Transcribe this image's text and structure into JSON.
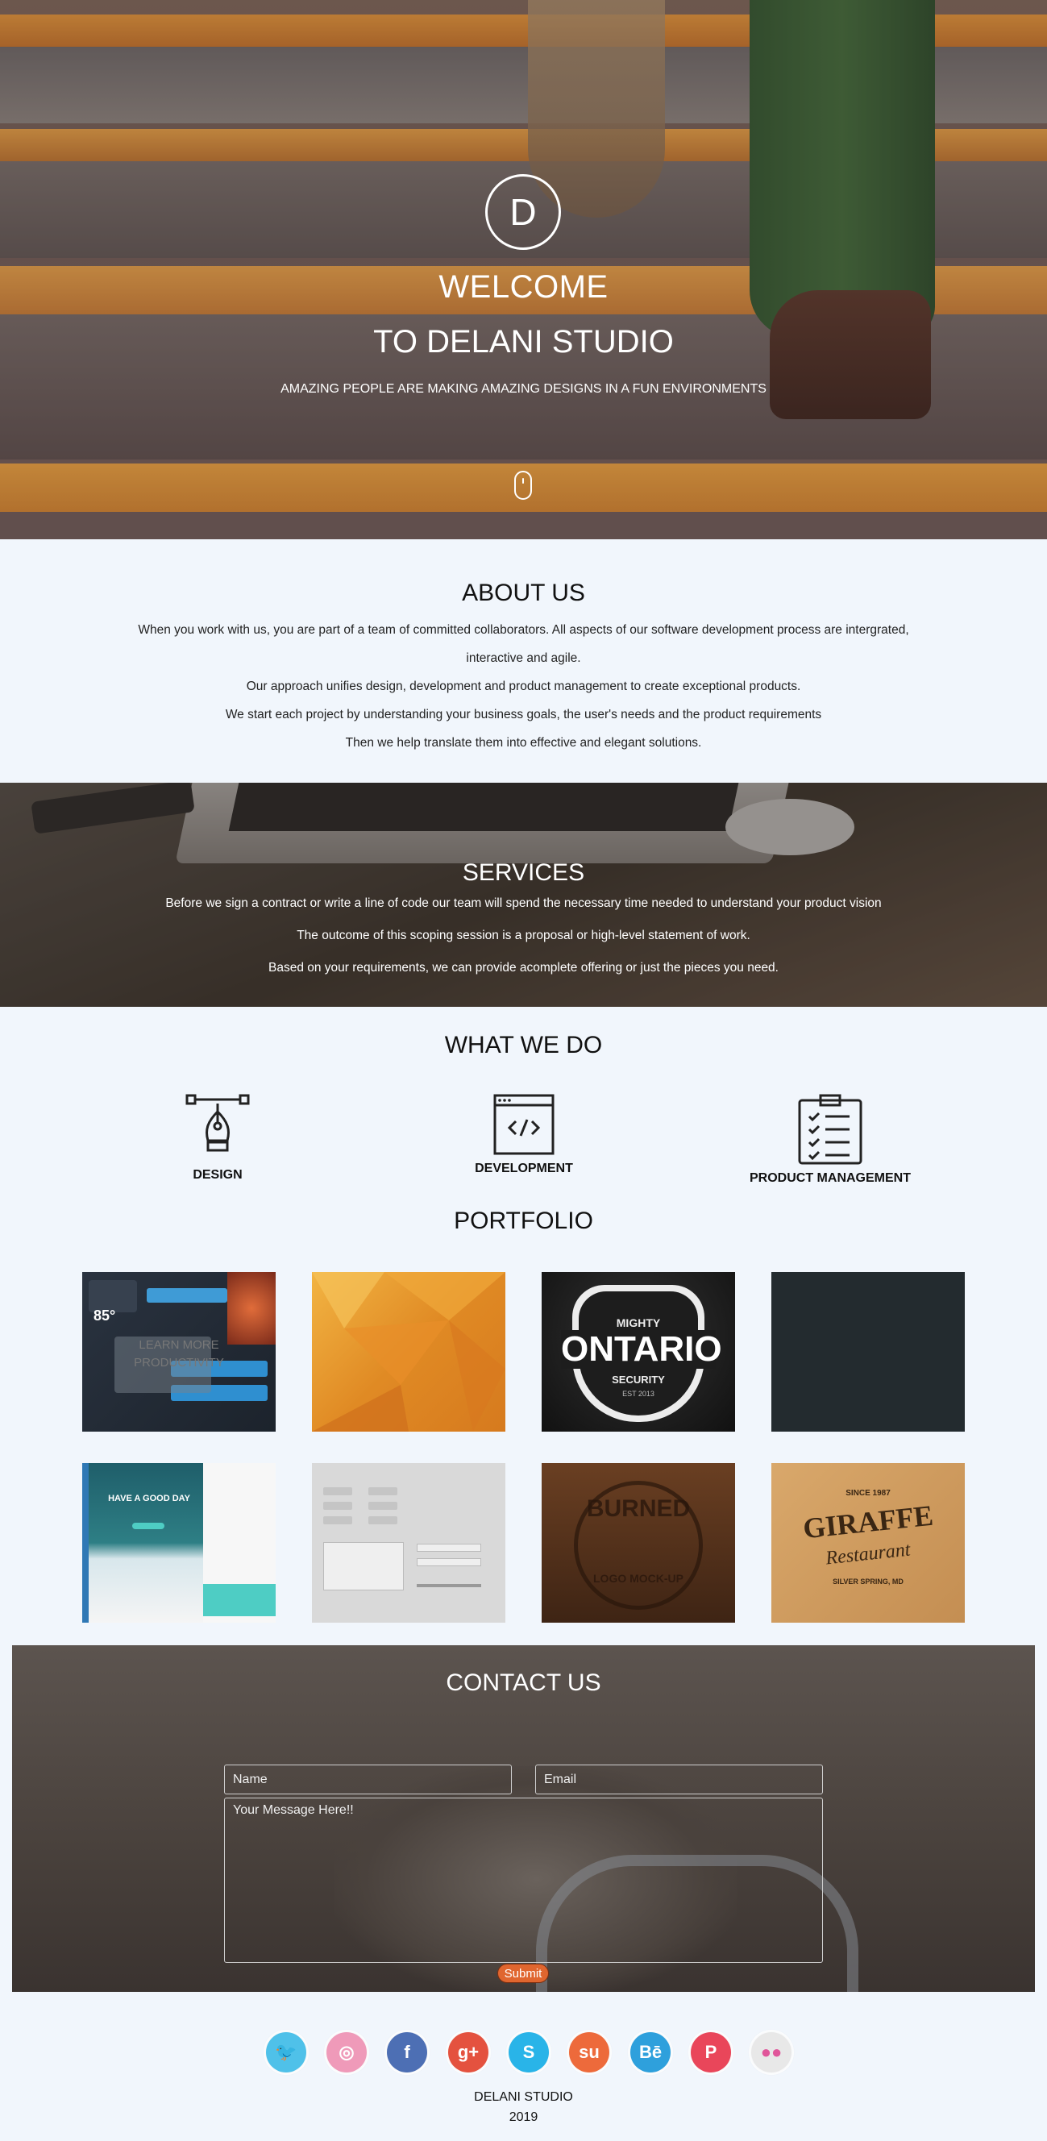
{
  "hero": {
    "logo_letter": "D",
    "title_line1": "WELCOME",
    "title_line2": "TO DELANI STUDIO",
    "tagline": "AMAZING PEOPLE ARE MAKING AMAZING DESIGNS IN A FUN ENVIRONMENTS"
  },
  "about": {
    "title": "ABOUT US",
    "lines": [
      "When you work with us, you are part of a team of committed collaborators. All aspects of our software development process are intergrated,",
      "interactive and agile.",
      "Our approach unifies design, development and product management to create exceptional products.",
      "We start each project by understanding your business goals, the user's needs and the product requirements",
      "Then we help translate them into effective and elegant solutions."
    ]
  },
  "services": {
    "title": "SERVICES",
    "lines": [
      "Before we sign a contract or write a line of code our team will spend the necessary time needed to understand your product vision",
      "The outcome of this scoping session is a proposal or high-level statement of work.",
      "Based on your requirements, we can provide acomplete offering or just the pieces you need."
    ]
  },
  "what_we_do": {
    "title": "WHAT WE DO",
    "items": [
      {
        "label": "DESIGN",
        "icon": "pen-tool-icon"
      },
      {
        "label": "DEVELOPMENT",
        "icon": "code-window-icon"
      },
      {
        "label": "PRODUCT MANAGEMENT",
        "icon": "clipboard-checklist-icon"
      }
    ]
  },
  "portfolio": {
    "title": "PORTFOLIO",
    "tiles": [
      {
        "name": "ui-dashboard-tile",
        "overlay_text": [
          "LEARN MORE",
          "PRODUCTIVITY"
        ]
      },
      {
        "name": "orange-polygon-tile"
      },
      {
        "name": "ontario-badge-tile",
        "text": [
          "MIGHTY",
          "ONTARIO",
          "SECURITY",
          "EST 2013"
        ]
      },
      {
        "name": "dark-blank-tile"
      },
      {
        "name": "mobile-app-tile",
        "text": [
          "HAVE A GOOD DAY"
        ]
      },
      {
        "name": "ui-kit-tile"
      },
      {
        "name": "burned-logo-tile",
        "text": [
          "BURNED",
          "LOGO MOCK-UP"
        ]
      },
      {
        "name": "giraffe-restaurant-tile",
        "text": [
          "SINCE 1987",
          "GIRAFFE",
          "Restaurant",
          "SILVER SPRING, MD"
        ]
      }
    ]
  },
  "contact": {
    "title": "CONTACT US",
    "name_placeholder": "Name",
    "email_placeholder": "Email",
    "message_placeholder": "Your Message Here!!",
    "submit_label": "Submit"
  },
  "footer": {
    "social": [
      {
        "name": "twitter-icon",
        "glyph": "🐦",
        "color": "#4fc1e9"
      },
      {
        "name": "dribbble-icon",
        "glyph": "◎",
        "color": "#ef9ab9"
      },
      {
        "name": "facebook-icon",
        "glyph": "f",
        "color": "#4d6fb4"
      },
      {
        "name": "google-plus-icon",
        "glyph": "g+",
        "color": "#e4523f"
      },
      {
        "name": "skype-icon",
        "glyph": "S",
        "color": "#29b4e8"
      },
      {
        "name": "stumbleupon-icon",
        "glyph": "su",
        "color": "#ed6a3b"
      },
      {
        "name": "behance-icon",
        "glyph": "Bē",
        "color": "#2ea0dc"
      },
      {
        "name": "pinterest-icon",
        "glyph": "P",
        "color": "#e9465a"
      },
      {
        "name": "flickr-icon",
        "glyph": "●●",
        "color": "#e8e8e8"
      }
    ],
    "studio_name": "DELANI STUDIO",
    "year": "2019"
  }
}
